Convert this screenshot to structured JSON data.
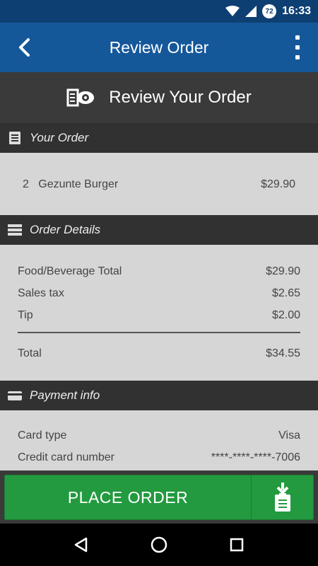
{
  "status_bar": {
    "time": "16:33",
    "battery_level": "72"
  },
  "app_bar": {
    "title": "Review Order"
  },
  "hero": {
    "title": "Review Your Order"
  },
  "your_order": {
    "header": "Your Order",
    "items": [
      {
        "qty": "2",
        "name": "Gezunte Burger",
        "price": "$29.90"
      }
    ]
  },
  "order_details": {
    "header": "Order Details",
    "rows": [
      {
        "label": "Food/Beverage Total",
        "value": "$29.90"
      },
      {
        "label": "Sales tax",
        "value": "$2.65"
      },
      {
        "label": "Tip",
        "value": "$2.00"
      }
    ],
    "total": {
      "label": "Total",
      "value": "$34.55"
    }
  },
  "payment_info": {
    "header": "Payment info",
    "rows": [
      {
        "label": "Card type",
        "value": "Visa"
      },
      {
        "label": "Credit card number",
        "value": "****-****-****-7006"
      }
    ]
  },
  "actions": {
    "place_order": "PLACE ORDER"
  },
  "colors": {
    "status_bar": "#0d3f72",
    "app_bar": "#15589a",
    "section_header": "#313131",
    "panel": "#d6d6d6",
    "place_button": "#239a3f"
  }
}
